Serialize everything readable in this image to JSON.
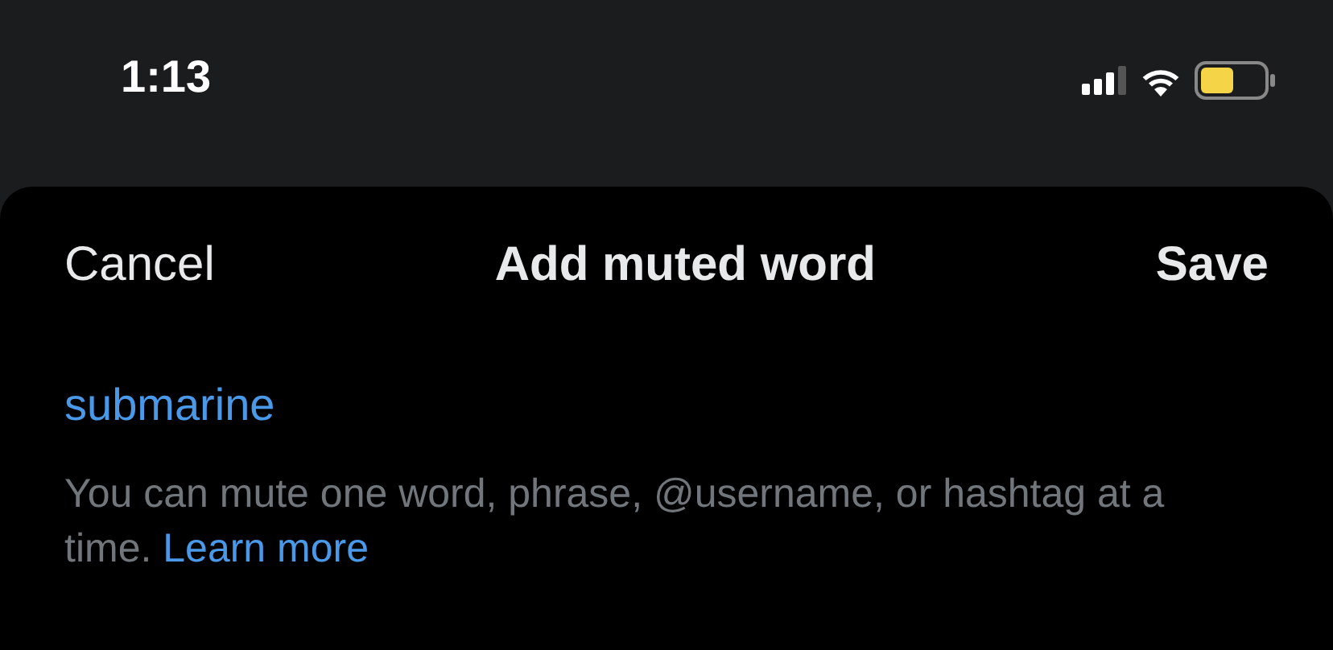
{
  "status_bar": {
    "time": "1:13"
  },
  "header": {
    "cancel": "Cancel",
    "title": "Add muted word",
    "save": "Save"
  },
  "field": {
    "value": "submarine"
  },
  "help": {
    "text": "You can mute one word, phrase, @username, or hashtag at a time.",
    "link": "Learn more"
  }
}
